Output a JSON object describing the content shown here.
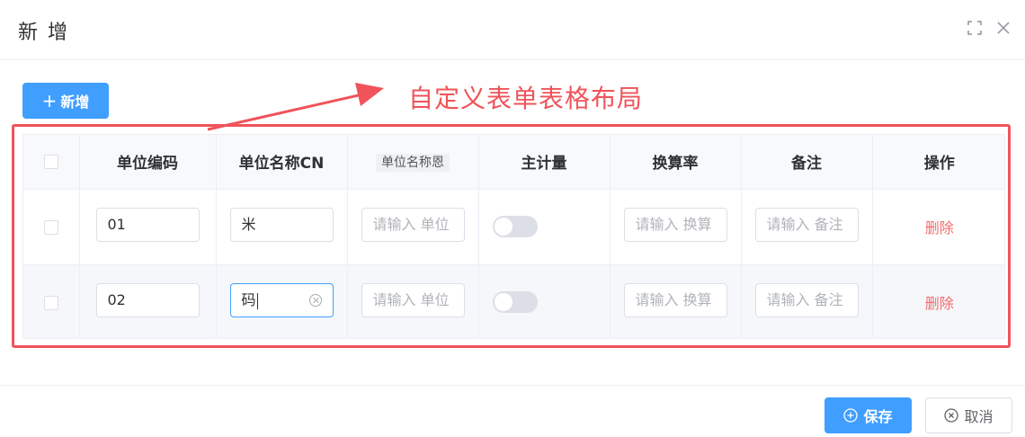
{
  "dialog": {
    "title": "新 增"
  },
  "toolbar": {
    "add_label": "新增"
  },
  "annotation": {
    "text": "自定义表单表格布局"
  },
  "table": {
    "columns": [
      "单位编码",
      "单位名称CN",
      "单位名称恩",
      "主计量",
      "换算率",
      "备注",
      "操作"
    ],
    "rows": [
      {
        "code": "01",
        "name_cn": "米",
        "name_en_placeholder": "请输入 单位",
        "main_unit": false,
        "rate_placeholder": "请输入 换算",
        "remark_placeholder": "请输入 备注",
        "action": "删除"
      },
      {
        "code": "02",
        "name_cn": "码",
        "name_en_placeholder": "请输入 单位",
        "main_unit": false,
        "rate_placeholder": "请输入 换算",
        "remark_placeholder": "请输入 备注",
        "action": "删除"
      }
    ]
  },
  "footer": {
    "save_label": "保存",
    "cancel_label": "取消"
  },
  "colors": {
    "primary": "#409eff",
    "danger": "#f56c6c",
    "annotation": "#f0535a"
  },
  "icons": {
    "fullscreen": "fullscreen-icon",
    "close": "close-icon",
    "plus": "plus-icon",
    "save": "circle-plus-icon",
    "cancel": "circle-close-icon"
  }
}
